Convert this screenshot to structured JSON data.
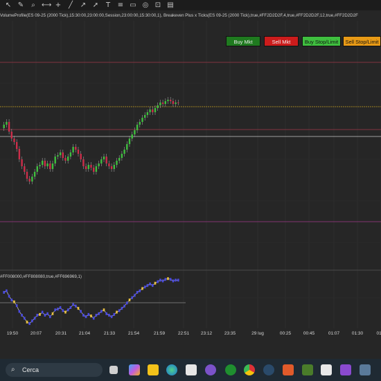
{
  "toolbar": {
    "icons": [
      "cursor-icon",
      "pencil-icon",
      "zoom-icon",
      "measure-icon",
      "crosshair-icon",
      "line-icon",
      "ray-icon",
      "arrow-icon",
      "text-icon",
      "fibonacci-icon",
      "shape-icon",
      "global-icon",
      "stay-icon",
      "properties-icon"
    ]
  },
  "indicator_line": "VolumeProfile(ES 09-25 (2000 Tick),15:30:00,23:00:00,Session,23:00:00,15:30:00,1), Breakeven Plus x Ticks(ES 09-25 (2000 Tick),true,#FF2D2D2F,4,true,#FF2D2D2F,12,true,#FF2D2D2F",
  "buttons": {
    "buy_mkt": "Buy Mkt",
    "sell_mkt": "Sell Mkt",
    "buy_stop_limit": "Buy Stop/Limit",
    "sell_stop_limit": "Sell Stop/Limit"
  },
  "colors": {
    "buy_mkt": "#1f7a1f",
    "sell_mkt": "#cc1c1c",
    "buy_stop_limit": "#3fbf3f",
    "sell_stop_limit": "#e89a16",
    "up_candle": "#3fbf3f",
    "down_candle": "#cc2d4a"
  },
  "sub_panel_label": "#FF008000,#FF808080,true,#FF696969,1)",
  "time_axis": [
    "19:50",
    "20:07",
    "20:31",
    "21:04",
    "21:33",
    "21:54",
    "21:59",
    "22:51",
    "23:12",
    "23:35",
    "29 lug",
    "00:25",
    "00:45",
    "01:07",
    "01:30",
    "01:"
  ],
  "taskbar": {
    "search_placeholder": "Cerca",
    "apps": [
      "task-view-icon",
      "copilot-icon",
      "file-explorer-icon",
      "edge-icon",
      "store-icon",
      "app-icon",
      "xbox-icon",
      "chrome-icon",
      "steam-icon",
      "app2-icon",
      "ninjatrader-icon",
      "app3-icon",
      "calculator-icon",
      "app4-icon"
    ]
  }
}
